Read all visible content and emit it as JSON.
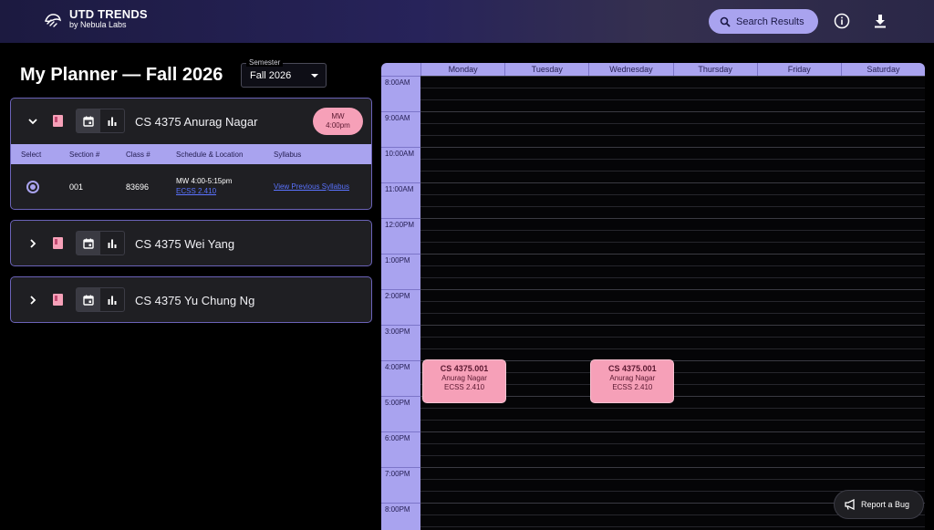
{
  "header": {
    "brand_title": "UTD TRENDS",
    "brand_subtitle": "by Nebula Labs",
    "search_label": "Search Results",
    "info_icon": "info-icon",
    "download_icon": "download-icon"
  },
  "planner": {
    "title": "My Planner — Fall 2026",
    "semester_label": "Semester",
    "semester_value": "Fall 2026"
  },
  "courses": [
    {
      "name": "CS 4375 Anurag Nagar",
      "expanded": true,
      "badge_days": "MW",
      "badge_time": "4:00pm",
      "table_headers": [
        "Select",
        "Section #",
        "Class #",
        "Schedule & Location",
        "Syllabus"
      ],
      "rows": [
        {
          "section": "001",
          "class_num": "83696",
          "schedule": "MW 4:00-5:15pm",
          "location": "ECSS 2.410",
          "syllabus": "View Previous Syllabus"
        }
      ]
    },
    {
      "name": "CS 4375 Wei Yang",
      "expanded": false
    },
    {
      "name": "CS 4375 Yu Chung Ng",
      "expanded": false
    }
  ],
  "calendar": {
    "days": [
      "Monday",
      "Tuesday",
      "Wednesday",
      "Thursday",
      "Friday",
      "Saturday"
    ],
    "times": [
      "8:00AM",
      "9:00AM",
      "10:00AM",
      "11:00AM",
      "12:00PM",
      "1:00PM",
      "2:00PM",
      "3:00PM",
      "4:00PM",
      "5:00PM",
      "6:00PM",
      "7:00PM",
      "8:00PM"
    ],
    "events": [
      {
        "day": "Monday",
        "title": "CS 4375.001",
        "instructor": "Anurag Nagar",
        "location": "ECSS 2.410"
      },
      {
        "day": "Wednesday",
        "title": "CS 4375.001",
        "instructor": "Anurag Nagar",
        "location": "ECSS 2.410"
      }
    ]
  },
  "footer": {
    "bug_label": "Report a Bug"
  },
  "colors": {
    "accent": "#a9a3ef",
    "event": "#f6a0b8",
    "card_border": "#6b63b8"
  }
}
